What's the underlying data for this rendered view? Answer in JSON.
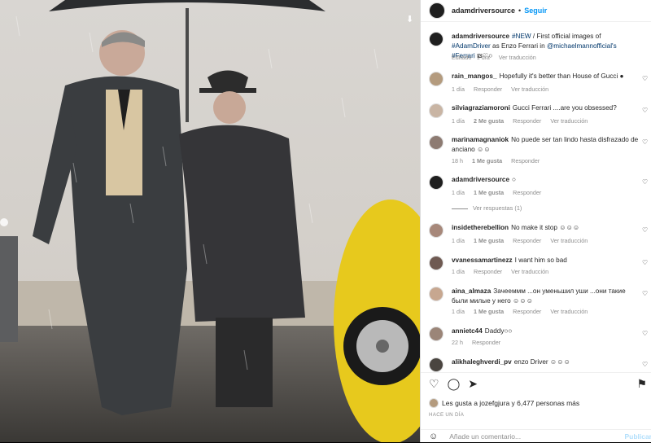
{
  "post": {
    "author": "adamdriversource",
    "follow_label": "Seguir",
    "caption_author": "adamdriversource",
    "caption_tag1": "#NEW",
    "caption_text1": " / First official images of ",
    "caption_tag2": "#AdamDriver",
    "caption_text2": " as Enzo Ferrari in ",
    "caption_mention": "@michaelmannofficial's",
    "caption_tag3": "#Ferrari",
    "caption_text3": " ₪♡○",
    "caption_meta": "Editado · 1 día",
    "translate_label": "Ver traducción"
  },
  "comments": [
    {
      "user": "rain_mangos_",
      "text": "Hopefully it's better than House of Gucci ●",
      "age": "1 día",
      "likes": "",
      "reply": "Responder",
      "translate": "Ver traducción"
    },
    {
      "user": "silviagraziamoroni",
      "text": "Gucci Ferrari ....are you obsessed?",
      "age": "1 día",
      "likes": "2 Me gusta",
      "reply": "Responder",
      "translate": "Ver traducción"
    },
    {
      "user": "marinamagnaniok",
      "text": "No puede ser tan lindo hasta disfrazado de anciano ☺☺",
      "age": "18 h",
      "likes": "1 Me gusta",
      "reply": "Responder",
      "translate": ""
    },
    {
      "user": "adamdriversource",
      "text": "○",
      "age": "1 día",
      "likes": "1 Me gusta",
      "reply": "Responder",
      "translate": ""
    },
    {
      "user": "insidetherebellion",
      "text": "No make it stop ☺☺☺",
      "age": "1 día",
      "likes": "1 Me gusta",
      "reply": "Responder",
      "translate": "Ver traducción"
    },
    {
      "user": "vvanessamartinezz",
      "text": "I want him so bad",
      "age": "1 día",
      "likes": "",
      "reply": "Responder",
      "translate": "Ver traducción"
    },
    {
      "user": "aina_almaza",
      "text": "Зачееммм ...он уменьшил уши ...они такие были милые у него ☺☺☺",
      "age": "1 día",
      "likes": "1 Me gusta",
      "reply": "Responder",
      "translate": "Ver traducción"
    },
    {
      "user": "annietc44",
      "text": "Daddy○○",
      "age": "22 h",
      "likes": "",
      "reply": "Responder",
      "translate": ""
    },
    {
      "user": "alikhaleghverdi_pv",
      "text": "enzo Driver ☺☺☺",
      "age": "",
      "likes": "",
      "reply": "",
      "translate": ""
    }
  ],
  "view_replies": "Ver respuestas (1)",
  "likes_text": "Les gusta a jozefgjura y 6,477 personas más",
  "date": "HACE UN DÍA",
  "add_comment_placeholder": "Añade un comentario...",
  "publish_label": "Publicar"
}
